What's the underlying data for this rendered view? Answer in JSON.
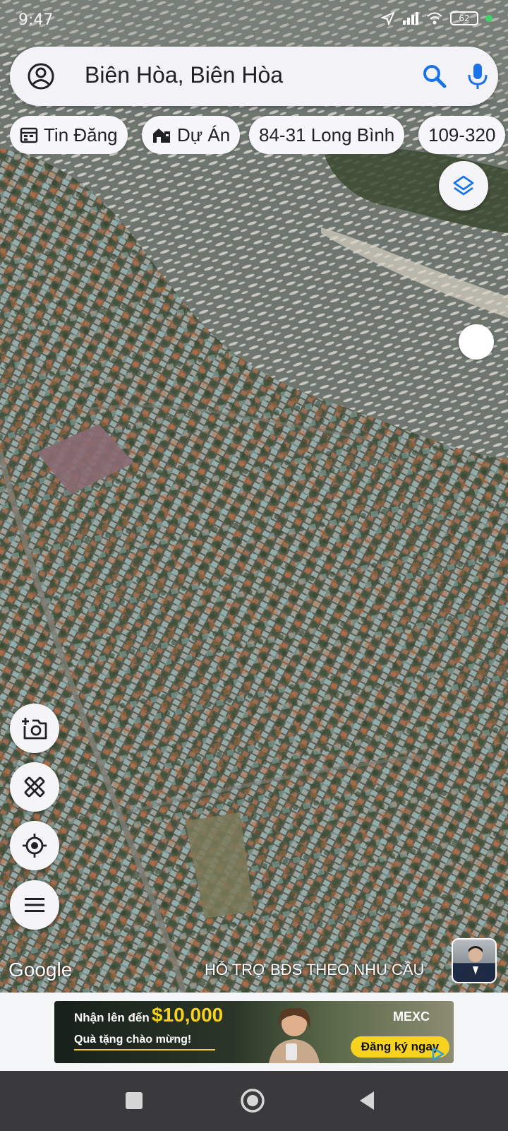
{
  "status_bar": {
    "time": "9:47",
    "battery": "62"
  },
  "search": {
    "text": "Biên Hòa, Biên Hòa"
  },
  "chips": [
    {
      "label": "Tin Đăng",
      "icon": "calendar-icon"
    },
    {
      "label": "Dự Án",
      "icon": "building-icon"
    },
    {
      "label": "84-31 Long Bình",
      "icon": ""
    },
    {
      "label": "109-320",
      "icon": ""
    }
  ],
  "map": {
    "attribution": "Google",
    "promo_text": "HỖ TRỢ BĐS  THEO NHU CẦU"
  },
  "ad": {
    "line1_prefix": "Nhận lên đến",
    "amount": "$10,000",
    "line2": "Quà tặng chào mừng!",
    "brand": "MEXC",
    "cta": "Đăng ký ngay"
  },
  "colors": {
    "accent": "#1a73e8",
    "chip_bg": "#f7f7fb",
    "ad_yellow": "#f7d21e",
    "nav_bar": "#3a3a3c"
  }
}
